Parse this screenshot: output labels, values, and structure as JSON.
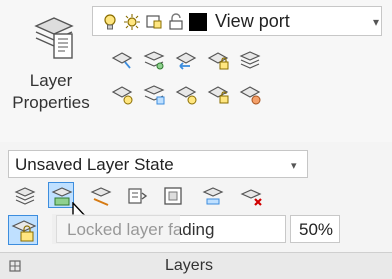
{
  "ribbon": {
    "layer_properties": {
      "label_line1": "Layer",
      "label_line2": "Properties",
      "icon": "layer-properties-icon"
    },
    "layer_combo": {
      "selected_value": "View port",
      "icons": [
        "bulb-icon",
        "sun-icon",
        "viewport-icon",
        "unlock-icon",
        "color-swatch-black"
      ]
    },
    "icons_row1": [
      "layer-match-icon",
      "layer-iso-icon",
      "layer-prev-icon",
      "layer-lock-icon",
      "layer-walk-icon"
    ],
    "icons_row2": [
      "layer-make-current-icon",
      "layer-copy-icon",
      "layer-freeze-icon",
      "layer-unlock-icon",
      "layer-merge-icon"
    ],
    "layer_state": {
      "selected_value": "Unsaved Layer State"
    },
    "icons_row3": [
      "layer-states-manager-icon",
      "isolate-icon",
      "unisolate-icon",
      "walk-icon",
      "layer-filter-icon",
      "vp-freeze-icon",
      "layer-delete-icon"
    ],
    "locked_fading": {
      "label": "Locked layer fading",
      "value": "50%"
    },
    "footer": {
      "title": "Layers"
    }
  }
}
